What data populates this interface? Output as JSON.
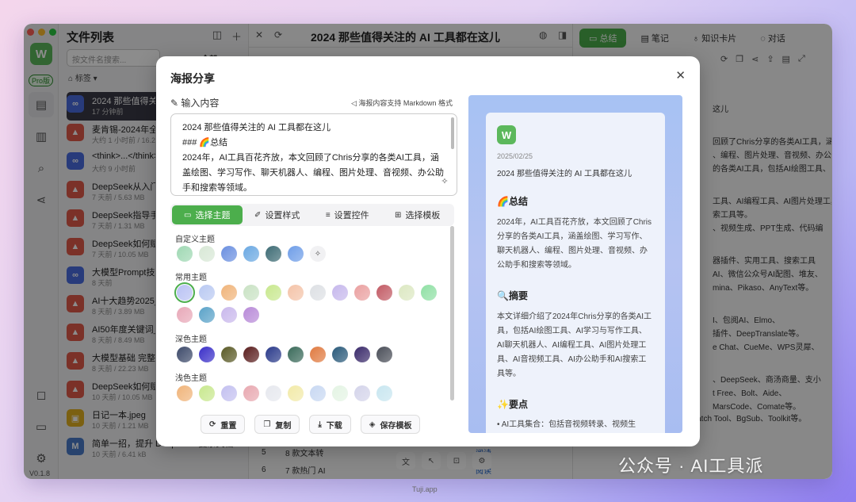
{
  "app": {
    "pro_badge": "Pro版",
    "version": "V0.1.8",
    "logo_letter": "W"
  },
  "filelist": {
    "title": "文件列表",
    "search_placeholder": "按文件名搜索...",
    "all_label": "全部",
    "tags_label": "标签",
    "files": [
      {
        "name": "2024 那些值得关注",
        "meta": "17 分钟前",
        "type": "link"
      },
      {
        "name": "麦肯锡-2024年全球",
        "meta": "大约 1 小时前 / 16.22",
        "type": "pdf"
      },
      {
        "name": "<think>...</think>",
        "meta": "大约 9 小时前",
        "type": "link"
      },
      {
        "name": "DeepSeek从入门到",
        "meta": "7 天前 / 5.63 MB",
        "type": "pdf"
      },
      {
        "name": "DeepSeek指导手册",
        "meta": "7 天前 / 1.31 MB",
        "type": "pdf"
      },
      {
        "name": "DeepSeek如何赋能",
        "meta": "7 天前 / 10.05 MB",
        "type": "pdf"
      },
      {
        "name": "大模型Prompt技巧",
        "meta": "8 天前",
        "type": "link"
      },
      {
        "name": "AI十大趋势2025_早",
        "meta": "8 天前 / 3.89 MB",
        "type": "pdf"
      },
      {
        "name": "AI50年度关键词_脑",
        "meta": "8 天前 / 8.49 MB",
        "type": "pdf"
      },
      {
        "name": "大模型基础 完整版",
        "meta": "8 天前 / 22.23 MB",
        "type": "pdf"
      },
      {
        "name": "DeepSeek如何赋能",
        "meta": "10 天前 / 10.05 MB",
        "type": "pdf"
      },
      {
        "name": "日记一本.jpeg",
        "meta": "10 天前 / 1.21 MB",
        "type": "img"
      },
      {
        "name": "简单一招，提升 DeepSeek 复杂文档...",
        "meta": "10 天前 / 6.41 kB",
        "type": "md"
      }
    ]
  },
  "header": {
    "doc_title": "2024 那些值得关注的 AI 工具都在这儿"
  },
  "rightpane": {
    "tabs": [
      {
        "label": "总结",
        "icon": "book-icon"
      },
      {
        "label": "笔记",
        "icon": "note-icon"
      },
      {
        "label": "知识卡片",
        "icon": "bulb-icon"
      },
      {
        "label": "对话",
        "icon": "chat-icon"
      }
    ],
    "content": [
      "这儿",
      "回顾了Chris分享的各类AI工具，涵",
      "、编程、图片处理、音视频、办公",
      "的各类AI工具，包括AI绘图工具、",
      "工具、AI编程工具、AI图片处理工具、",
      "索工具等。",
      "、视频生成、PPT生成、代码编",
      "器插件、实用工具、搜索工具",
      "AI、微信公众号AI配图、堆友、",
      "mina、Pikaso、AnyText等。",
      "I、包阅AI、Elmo、",
      "插件、DeepTranslate等。",
      "e Chat、CueMe、WPS灵犀、",
      "、DeepSeek、商汤商量、支小",
      "t Free、Bolt、Aide、",
      "MarsCode、Comate等。",
      "AI图片处理工具：如Batch Tool、BgSub、Toolkit等。"
    ]
  },
  "table": {
    "rows": [
      {
        "num": "5",
        "text": "8 款文本转",
        "action": "阅读"
      },
      {
        "num": "6",
        "text": "7 款热门 AI",
        "action": "阅读"
      }
    ]
  },
  "modal": {
    "title": "海报分享",
    "input_label": "输入内容",
    "markdown_hint": "海报内容支持 Markdown 格式",
    "textarea_lines": [
      "2024 那些值得关注的 AI 工具都在这儿",
      "### 🌈总结",
      "2024年，AI工具百花齐放，本文回顾了Chris分享的各类AI工具，涵盖绘图、学习写作、聊天机器人、编程、图片处理、音视频、办公助手和搜索等领域。"
    ],
    "segments": [
      {
        "label": "选择主题",
        "icon": "book-icon",
        "active": true
      },
      {
        "label": "设置样式",
        "icon": "brush-icon",
        "active": false
      },
      {
        "label": "设置控件",
        "icon": "sliders-icon",
        "active": false
      },
      {
        "label": "选择模板",
        "icon": "grid-icon",
        "active": false
      }
    ],
    "sections": {
      "custom": "自定义主题",
      "common": "常用主题",
      "dark": "深色主题",
      "light": "浅色主题"
    },
    "swatches": {
      "custom": [
        "#9fd8b3",
        "#d8e8d6",
        "#6a8fe0",
        "#6aa8e2",
        "#3d6b74",
        "#6e9de8"
      ],
      "common": [
        "#b9c2f4",
        "#b9c9f2",
        "#f0b47a",
        "#c9e2c4",
        "#c8e88e",
        "#f4c3a8",
        "#dde0e4",
        "#c6b8ec",
        "#eaa0a0",
        "#c25a64",
        "#dce8c2",
        "#8fe0a4",
        "#e8a8b8",
        "#5aa2c8",
        "#c9b8ec",
        "#b88ad8"
      ],
      "dark": [
        "#3d4a6a",
        "#3a2fc8",
        "#5a5a26",
        "#5a1e1e",
        "#2a3a8a",
        "#3a6a5a",
        "#e07a40",
        "#2a5a7a",
        "#3a2a6a",
        "#4a4e58"
      ],
      "light": [
        "#f0b47a",
        "#c8e88e",
        "#c3c0f0",
        "#e8a8b0",
        "#e6e8ee",
        "#f2eaa8",
        "#c8d8f2",
        "#e4f4e4",
        "#d4d4ea",
        "#c8e6f0"
      ]
    },
    "actions": [
      {
        "label": "重置",
        "icon": "refresh-icon"
      },
      {
        "label": "复制",
        "icon": "clipboard-icon"
      },
      {
        "label": "下载",
        "icon": "download-icon"
      },
      {
        "label": "保存模板",
        "icon": "box-icon"
      }
    ],
    "preview": {
      "date": "2025/02/25",
      "title": "2024 那些值得关注的 AI 工具都在这儿",
      "h_summary": "🌈总结",
      "p_summary": "2024年，AI工具百花齐放，本文回顾了Chris分享的各类AI工具，涵盖绘图、学习写作、聊天机器人、编程、图片处理、音视频、办公助手和搜索等领域。",
      "h_abstract": "🔍摘要",
      "p_abstract": "本文详细介绍了2024年Chris分享的各类AI工具，包括AI绘图工具、AI学习与写作工具、AI聊天机器人、AI编程工具、AI图片处理工具、AI音视频工具、AI办公助手和AI搜索工具等。",
      "h_points": "✨要点",
      "li_1": "• AI工具集合：包括音视频转录、视频生"
    }
  },
  "watermark": "公众号 · AI工具派",
  "footer_tag": "Tuji.app",
  "colors": {
    "accent": "#4cae4c",
    "pdf": "#e05a4a",
    "link": "#4a6ce0"
  }
}
